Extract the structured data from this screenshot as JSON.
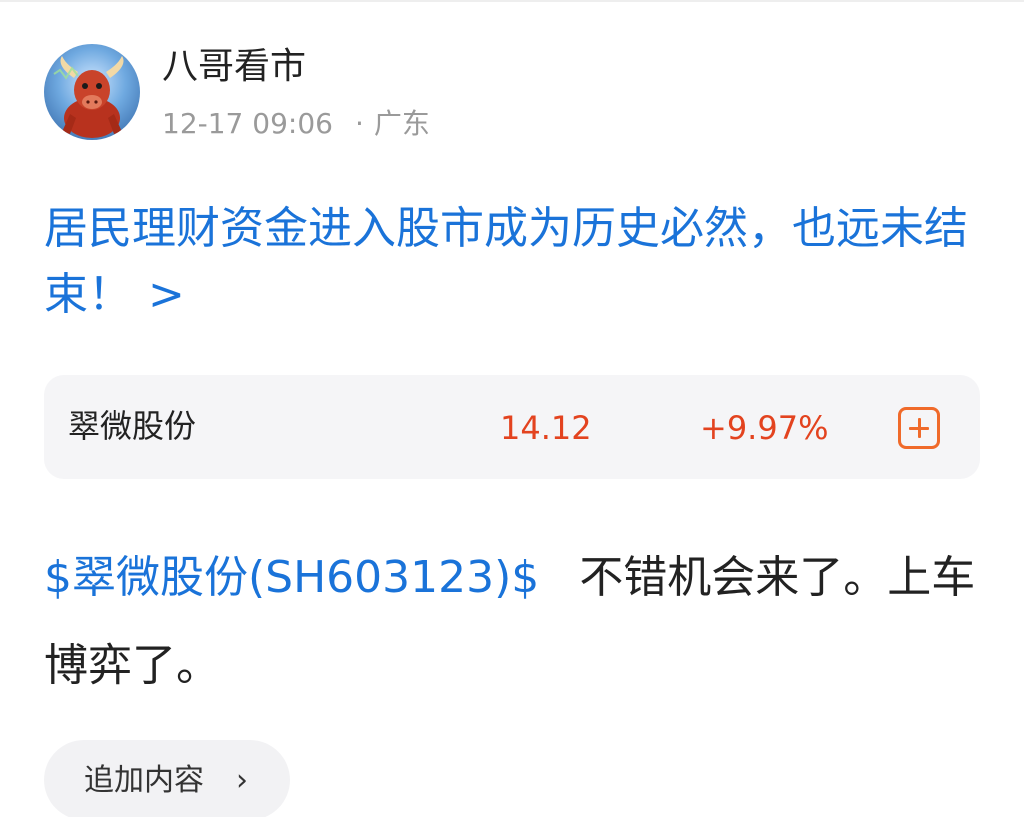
{
  "author": {
    "name": "八哥看市",
    "avatar_icon": "bull-avatar-icon"
  },
  "meta": {
    "timestamp": "12-17 09:06",
    "separator": "·",
    "location": "广东"
  },
  "post": {
    "title": "居民理财资金进入股市成为历史必然，也远未结束！",
    "title_chevron": ">",
    "body_tag": "$翠微股份(SH603123)$",
    "body_text": "不错机会来了。上车博弈了。"
  },
  "stock_card": {
    "name": "翠微股份",
    "price": "14.12",
    "change": "+9.97%",
    "add_icon": "plus-square-icon"
  },
  "append": {
    "label": "追加内容",
    "chevron": "›"
  },
  "colors": {
    "link_blue": "#1a73d9",
    "price_red": "#e3431f",
    "add_orange": "#f06a2a",
    "text_dark": "#222222",
    "meta_gray": "#9a9a9a",
    "card_bg": "#f5f5f7"
  }
}
